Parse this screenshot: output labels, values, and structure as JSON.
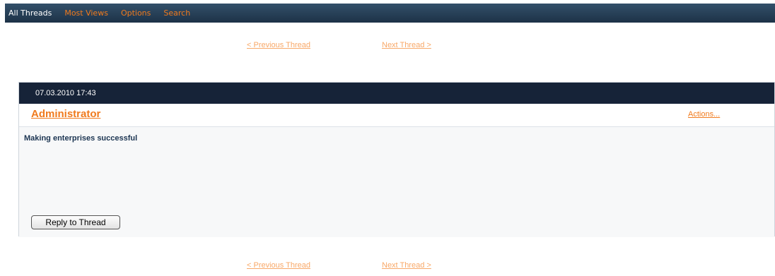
{
  "nav": {
    "tabs": [
      {
        "label": "All Threads",
        "active": true
      },
      {
        "label": "Most Views",
        "active": false
      },
      {
        "label": "Options",
        "active": false
      },
      {
        "label": "Search",
        "active": false
      }
    ]
  },
  "pager": {
    "prev_label": "< Previous Thread",
    "next_label": "Next Thread >"
  },
  "post": {
    "timestamp": "07.03.2010 17:43",
    "author": "Administrator",
    "actions_label": "Actions...",
    "message": "Making enterprises successful",
    "reply_label": "Reply to Thread"
  },
  "colors": {
    "nav_bg": "#2a4560",
    "link_orange": "#f07a1d",
    "link_faded": "#f8a868",
    "post_header_bg": "#162338",
    "message_text": "#1c3552"
  }
}
